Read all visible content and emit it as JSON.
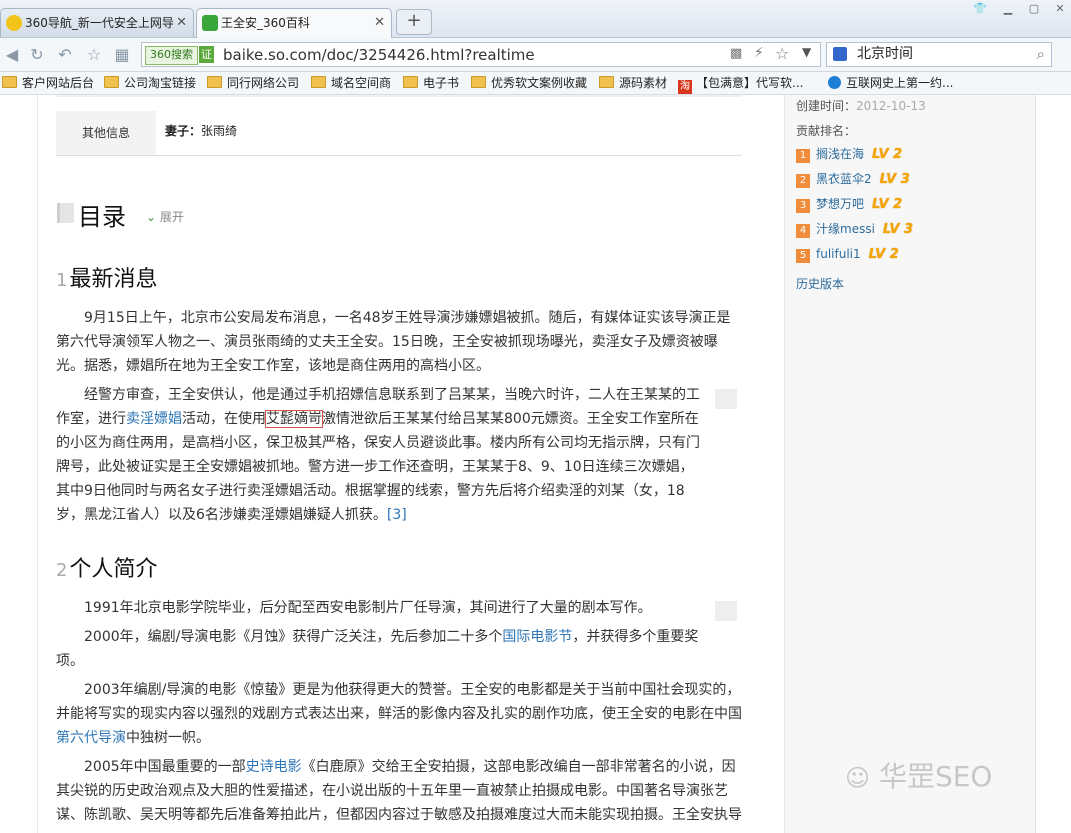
{
  "tabs": [
    {
      "label": "360导航_新一代安全上网导",
      "icon": "360-logo-icon"
    },
    {
      "label": "王全安_360百科",
      "icon": "360-search-icon"
    }
  ],
  "new_tab_label": "+",
  "address_bar": {
    "search_badge": "360搜索",
    "cert_badge": "证",
    "url": "baike.so.com/doc/3254426.html?realtime"
  },
  "search_box": {
    "value": "北京时间"
  },
  "bookmarks": [
    "客户网站后台",
    "公司淘宝链接",
    "同行网络公司",
    "域名空间商",
    "电子书",
    "优秀软文案例收藏",
    "源码素材",
    "【包满意】代写软...",
    "互联网史上第一约..."
  ],
  "infobox": {
    "label": "其他信息",
    "value_key": "妻子：",
    "value": "张雨绮"
  },
  "toc": {
    "title": "目录",
    "expand": "展开"
  },
  "sections": [
    {
      "num": "1",
      "title": "最新消息"
    },
    {
      "num": "2",
      "title": "个人简介"
    }
  ],
  "para1": "9月15日上午，北京市公安局发布消息，一名48岁王姓导演涉嫌嫖娼被抓。随后，有媒体证实该导演正是第六代导演领军人物之一、演员张雨绮的丈夫王全安。15日晚，王全安被抓现场曝光，卖淫女子及嫖资被曝光。据悉，嫖娼所在地为王全安工作室，该地是商住两用的高档小区。",
  "para2": {
    "a": "经警方审查，王全安供认，他是通过手机招嫖信息联系到了吕某某，当晚六时许，二人在王某某的工作室，进行",
    "link": "卖淫嫖娼",
    "b": "活动，在使用",
    "garbled": "艾髭嫡岢",
    "c": "激情泄欲后王某某付给吕某某800元嫖资。王全安工作室所在的小区为商住两用，是高档小区，保卫极其严格，保安人员避谈此事。楼内所有公司均无指示牌，只有门牌号，此处被证实是王全安嫖娼被抓地。警方进一步工作还查明，王某某于8、9、10日连续三次嫖娼，其中9日他同时与两名女子进行卖淫嫖娼活动。根据掌握的线索，警方先后将介绍卖淫的刘某（女，18岁，黑龙江省人）以及6名涉嫌卖淫嫖娼嫌疑人抓获。",
    "ref": "[3]"
  },
  "para3": "1991年北京电影学院毕业，后分配至西安电影制片厂任导演，其间进行了大量的剧本写作。",
  "para4": {
    "a": "2000年，编剧/导演电影《月蚀》获得广泛关注，先后参加二十多个",
    "link": "国际电影节",
    "b": "，并获得多个重要奖项。"
  },
  "para5": {
    "a": "2003年编剧/导演的电影《惊蛰》更是为他获得更大的赞誉。王全安的电影都是关于当前中国社会现实的，并能将写实的现实内容以强烈的戏剧方式表达出来，鲜活的影像内容及扎实的剧作功底，使王全安的电影在中国",
    "link": "第六代导演",
    "b": "中独树一帜。"
  },
  "para6": {
    "a": "2005年中国最重要的一部",
    "link": "史诗电影",
    "b": "《白鹿原》交给王全安拍摄，这部电影改编自一部非常著名的小说，因其尖锐的历史政治观点及大胆的性爱描述，在小说出版的十五年里一直被禁止拍摄成电影。中国著名导演张艺谋、陈凯歌、吴天明等都先后准备筹拍此片，但都因内容过于敏感及拍摄难度过大而未能实现拍摄。王全安执导"
  },
  "sidebar": {
    "created_label": "创建时间：",
    "created_date": "2012-10-13",
    "rank_label": "贡献排名：",
    "contributors": [
      {
        "rank": "1",
        "name": "搁浅在海",
        "level": "LV 2"
      },
      {
        "rank": "2",
        "name": "黑衣蓝伞2",
        "level": "LV 3"
      },
      {
        "rank": "3",
        "name": "梦想万吧",
        "level": "LV 2"
      },
      {
        "rank": "4",
        "name": "汁缘messi",
        "level": "LV 3"
      },
      {
        "rank": "5",
        "name": "fulifuli1",
        "level": "LV 2"
      }
    ],
    "history_link": "历史版本"
  },
  "watermark": "华罡SEO",
  "colors": {
    "link": "#2f76b6",
    "rank_badge": "#f08c3a",
    "level": "#f5a400"
  }
}
